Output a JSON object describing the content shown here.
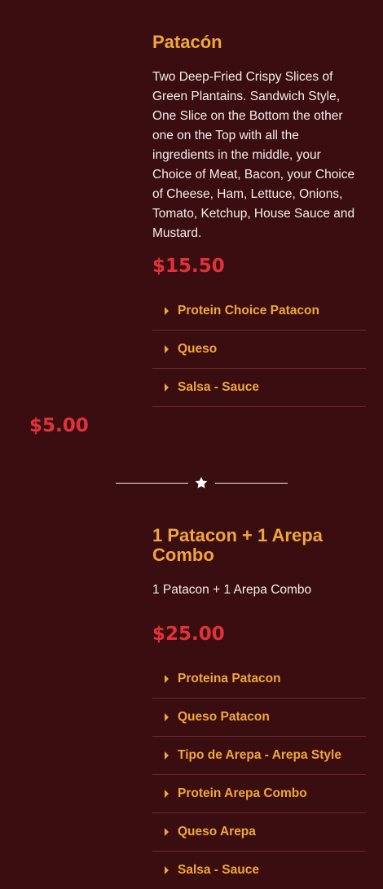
{
  "item1": {
    "title": "Patacón",
    "description": "Two Deep-Fried Crispy Slices of Green Plantains. Sandwich Style, One Slice on the Bottom the other one on the Top with all the ingredients in the middle, your Choice of Meat, Bacon, your Choice of Cheese, Ham, Lettuce, Onions, Tomato, Ketchup, House Sauce and Mustard.",
    "price": "$15.50",
    "options": [
      {
        "label": "Protein Choice Patacon"
      },
      {
        "label": "Queso"
      },
      {
        "label": "Salsa - Sauce"
      }
    ]
  },
  "side_price": "$5.00",
  "divider": {
    "icon": "star-icon"
  },
  "item2": {
    "title": "1 Patacon + 1 Arepa Combo",
    "description": "1 Patacon + 1 Arepa Combo",
    "price": "$25.00",
    "options": [
      {
        "label": "Proteina Patacon"
      },
      {
        "label": "Queso Patacon"
      },
      {
        "label": "Tipo de Arepa - Arepa Style"
      },
      {
        "label": "Protein Arepa Combo"
      },
      {
        "label": "Queso Arepa"
      },
      {
        "label": "Salsa - Sauce"
      }
    ]
  },
  "colors": {
    "background": "#3a0e10",
    "accent": "#f0a63c",
    "price": "#e0323a",
    "text": "#f4ecec"
  }
}
